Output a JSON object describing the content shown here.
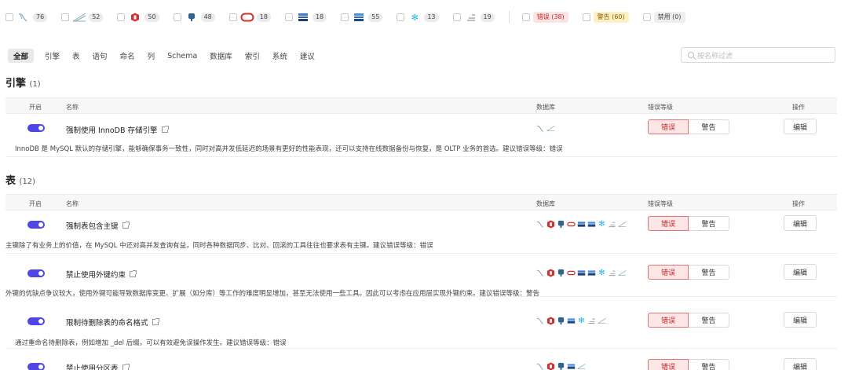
{
  "filters": {
    "db_counts": [
      {
        "icon": "mysql-icon",
        "count": "76"
      },
      {
        "icon": "tidb-icon",
        "count": "52"
      },
      {
        "icon": "redis-icon",
        "count": "50"
      },
      {
        "icon": "postgresql-icon",
        "count": "48"
      },
      {
        "icon": "oracle-icon",
        "count": "18"
      },
      {
        "icon": "sqlserver-icon",
        "count": "18"
      },
      {
        "icon": "mssql-icon",
        "count": "55"
      },
      {
        "icon": "snowflake-icon",
        "count": "13"
      },
      {
        "icon": "clickhouse-icon",
        "count": "19"
      }
    ],
    "levels": [
      {
        "label": "错误 (38)",
        "kind": "err"
      },
      {
        "label": "警告 (60)",
        "kind": "warn"
      },
      {
        "label": "禁用 (0)",
        "kind": "off"
      }
    ]
  },
  "tabs": [
    "全部",
    "引擎",
    "表",
    "语句",
    "命名",
    "列",
    "Schema",
    "数据库",
    "索引",
    "系统",
    "建议"
  ],
  "search": {
    "placeholder": "按名称过滤"
  },
  "table_headers": {
    "enable": "开启",
    "name": "名称",
    "database": "数据库",
    "level": "错误等级",
    "action": "操作"
  },
  "level_buttons": {
    "error": "错误",
    "warning": "警告"
  },
  "edit_label": "编辑",
  "sections": [
    {
      "title": "引擎",
      "count": "(1)",
      "rules": [
        {
          "name": "强制使用 InnoDB 存储引擎",
          "desc": "InnoDB 是 MySQL 默认的存储引擎，能够确保事务一致性，同时对高并发低延迟的场景有更好的性能表现，还可以支持在线数据备份与恢复，是 OLTP 业务的首选。建议错误等级：错误",
          "dbs": [
            "mysql-icon",
            "tidb-icon"
          ]
        }
      ]
    },
    {
      "title": "表",
      "count": "(12)",
      "rules": [
        {
          "name": "强制表包含主键",
          "desc": "主键除了有业务上的价值，在 MySQL 中还对高并发查询有益，同时各种数据同步、比对、回滚的工具往往也要求表有主键。建议错误等级：错误",
          "dbs": [
            "mysql-icon",
            "redis-icon",
            "postgresql-icon",
            "oracle-icon",
            "sqlserver-icon",
            "mssql-icon",
            "snowflake-icon",
            "clickhouse-icon",
            "tidb-icon"
          ]
        },
        {
          "name": "禁止使用外键约束",
          "desc": "外键的优缺点争议较大，使用外键可能导致数据库变更、扩展（如分库）等工作的难度明显增加，甚至无法使用一些工具。因此可以考虑在应用层实现外键约束。建议错误等级：警告",
          "dbs": [
            "mysql-icon",
            "redis-icon",
            "postgresql-icon",
            "oracle-icon",
            "sqlserver-icon",
            "mssql-icon",
            "snowflake-icon",
            "clickhouse-icon",
            "tidb-icon"
          ]
        },
        {
          "name": "限制待删除表的命名格式",
          "desc": "通过重命名待删除表，例如增加 _del 后缀，可以有效避免误操作发生。建议错误等级：错误",
          "dbs": [
            "mysql-icon",
            "redis-icon",
            "postgresql-icon",
            "mssql-icon",
            "snowflake-icon",
            "clickhouse-icon",
            "tidb-icon"
          ]
        },
        {
          "name": "禁止使用分区表",
          "desc": "",
          "dbs": [
            "mysql-icon",
            "redis-icon",
            "postgresql-icon",
            "mssql-icon",
            "tidb-icon"
          ]
        }
      ]
    }
  ],
  "colors": {
    "accent": "#4f46e5",
    "error": "#c62828",
    "warning": "#8a5a00"
  }
}
